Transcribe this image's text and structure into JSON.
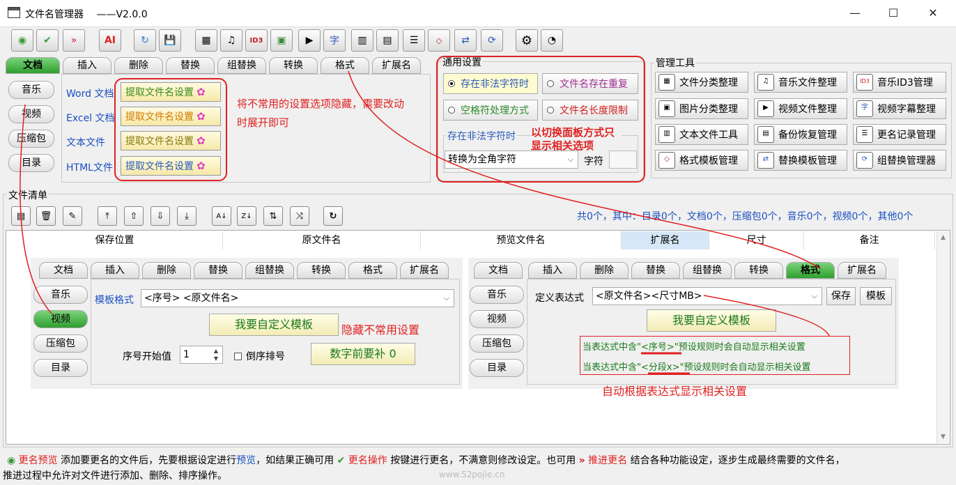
{
  "window": {
    "title": "文件名管理器",
    "version": "——V2.0.0",
    "minimize": "—",
    "maximize": "☐",
    "close": "✕"
  },
  "toolbar": {
    "icons": [
      "preview-icon",
      "execute-icon",
      "advance-icon",
      "ai-icon",
      "refresh-icon",
      "save-schedule-icon",
      "classify-icon",
      "music-icon",
      "id3-icon",
      "image-icon",
      "video-icon",
      "subtitle-icon",
      "text-tool-icon",
      "backup-icon",
      "history-icon",
      "format-template-icon",
      "replace-template-icon",
      "group-replace-icon",
      "settings-icon",
      "feedback-icon"
    ],
    "ai_label": "AI",
    "id3_label": "ID3",
    "sub_label": "字"
  },
  "top_tabs": [
    "文档",
    "插入",
    "删除",
    "替换",
    "组替换",
    "转换",
    "格式",
    "扩展名"
  ],
  "side_tabs": [
    "音乐",
    "视频",
    "压缩包",
    "目录"
  ],
  "doc_types": [
    "Word 文档",
    "Excel 文档",
    "文本文件",
    "HTML文件"
  ],
  "extract_label": "提取文件名设置",
  "annotation1": "将不常用的设置选项隐藏，需要改动时展开即可",
  "general": {
    "title": "通用设置",
    "opt1": "存在非法字符时",
    "opt2": "文件名存在重复",
    "opt3": "空格符处理方式",
    "opt4": "文件名长度限制",
    "sub_title": "存在非法字符时",
    "select_value": "转换为全角字符",
    "char_label": "字符",
    "annotation": "以切换面板方式只显示相关选项"
  },
  "manage": {
    "title": "管理工具",
    "buttons": [
      "文件分类整理",
      "音乐文件整理",
      "音乐ID3管理",
      "图片分类整理",
      "视频文件整理",
      "视频字幕整理",
      "文本文件工具",
      "备份恢复管理",
      "更名记录管理",
      "格式模板管理",
      "替换模板管理",
      "组替换管理器"
    ]
  },
  "file_list": {
    "title": "文件清单",
    "stats": "共0个，其中：目录0个，文档0个，压缩包0个，音乐0个，视频0个，其他0个",
    "columns": [
      "保存位置",
      "原文件名",
      "预览文件名",
      "扩展名",
      "尺寸",
      "备注"
    ]
  },
  "left_panel": {
    "tabs": [
      "文档",
      "插入",
      "删除",
      "替换",
      "组替换",
      "转换",
      "格式",
      "扩展名"
    ],
    "side": [
      "音乐",
      "视频",
      "压缩包",
      "目录"
    ],
    "template_label": "模板格式",
    "template_value": "<序号> <原文件名>",
    "custom_btn": "我要自定义模板",
    "hide_note": "隐藏不常用设置",
    "start_label": "序号开始值",
    "start_value": "1",
    "reverse_label": "倒序排号",
    "pad_btn": "数字前要补  0"
  },
  "right_panel": {
    "tabs": [
      "文档",
      "插入",
      "删除",
      "替换",
      "组替换",
      "转换",
      "格式",
      "扩展名"
    ],
    "side": [
      "音乐",
      "视频",
      "压缩包",
      "目录"
    ],
    "expr_label": "定义表达式",
    "expr_value": "<原文件名><尺寸MB>",
    "save_btn": "保存",
    "template_btn": "模板",
    "custom_btn": "我要自定义模板",
    "note1": "当表达式中含\"<序号>\"预设规则时会自动显示相关设置",
    "note2": "当表达式中含\"<分段x>\"预设规则时会自动显示相关设置",
    "auto_note": "自动根据表达式显示相关设置"
  },
  "status": {
    "preview_label": "更名预览",
    "text1": "添加要更名的文件后，先要根据设定进行",
    "preview_link": "预览",
    "text2": "，如结果正确可用",
    "exec_label": "更名操作",
    "text3": "按键进行更名，不满意则修改设定。也可用",
    "advance_label": "推进更名",
    "text4": "结合各种功能设定，逐步生成最终需要的文件名，",
    "line2": "推进过程中允许对文件进行添加、删除、排序操作。",
    "watermark": "www.52pojie.cn"
  },
  "colors": {
    "accent_green": "#2f9f2f",
    "annotation_red": "#e02020",
    "link_blue": "#1a4fc0"
  }
}
